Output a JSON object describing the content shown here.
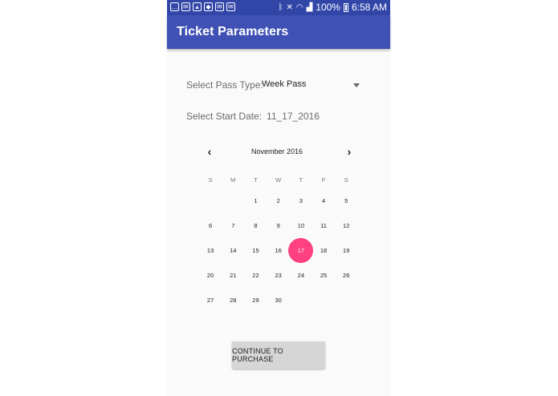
{
  "status_bar": {
    "battery_percent": "100%",
    "time": "6:58 AM",
    "left_icons": [
      "chat-icon",
      "mail-icon",
      "image-icon",
      "shield-icon",
      "email-icon",
      "mail-icon"
    ],
    "right_icons": [
      "bluetooth-icon",
      "mute-icon",
      "wifi-icon",
      "signal-icon",
      "battery-icon"
    ]
  },
  "app_bar": {
    "title": "Ticket Parameters",
    "color": "#3f51b5"
  },
  "form": {
    "pass_type_label": "Select Pass Type:",
    "pass_type_value": "Week Pass",
    "start_date_label": "Select Start Date:",
    "start_date_value": "11_17_2016"
  },
  "calendar": {
    "month_title": "November 2016",
    "prev_icon": "chevron-left-icon",
    "next_icon": "chevron-right-icon",
    "weekdays": [
      "S",
      "M",
      "T",
      "W",
      "T",
      "F",
      "S"
    ],
    "weeks": [
      [
        "",
        "",
        "1",
        "2",
        "3",
        "4",
        "5"
      ],
      [
        "6",
        "7",
        "8",
        "9",
        "10",
        "11",
        "12"
      ],
      [
        "13",
        "14",
        "15",
        "16",
        "17",
        "18",
        "19"
      ],
      [
        "20",
        "21",
        "22",
        "23",
        "24",
        "25",
        "26"
      ],
      [
        "27",
        "28",
        "29",
        "30",
        "",
        "",
        ""
      ]
    ],
    "selected_day": "17",
    "selected_color": "#ff4081"
  },
  "actions": {
    "continue_label": "CONTINUE TO PURCHASE"
  }
}
